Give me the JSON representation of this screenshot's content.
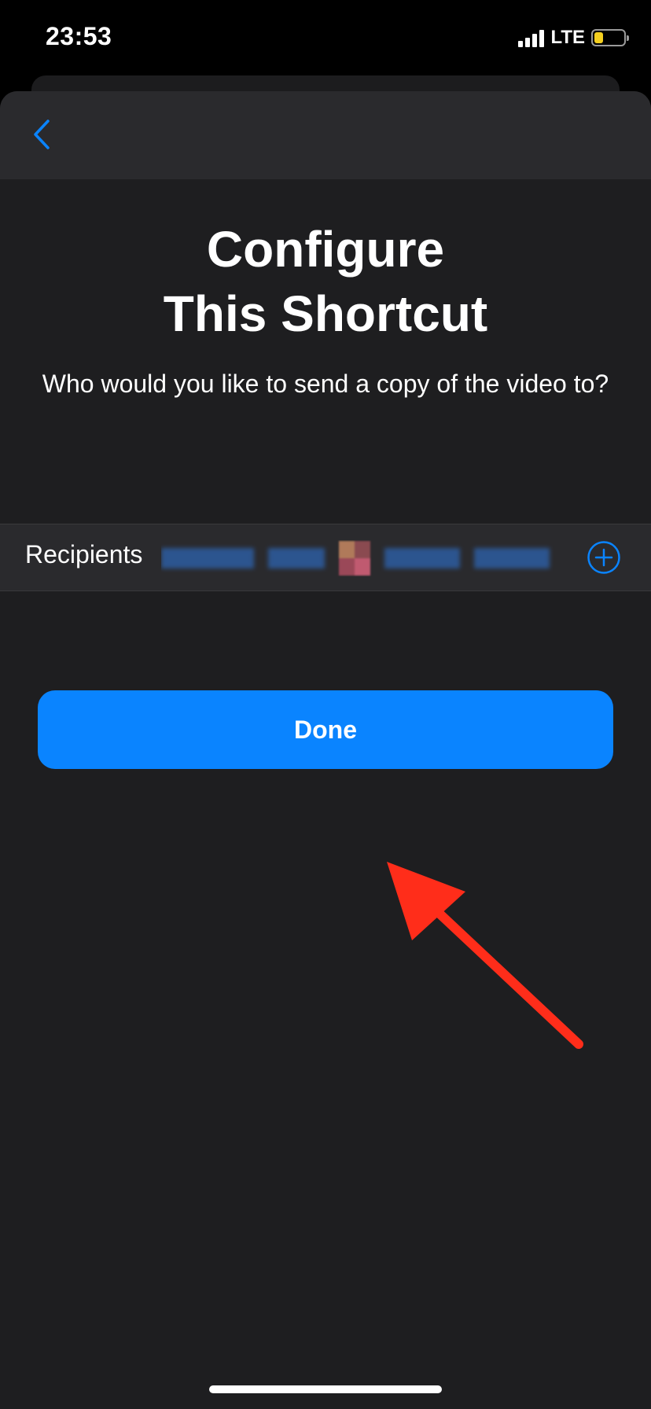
{
  "status_bar": {
    "time": "23:53",
    "network": "LTE",
    "signal_icon": "signal-bars-icon",
    "battery_icon": "battery-icon",
    "battery_color": "#f4cf1f",
    "battery_level": 0.3
  },
  "nav": {
    "back_icon": "chevron-left-icon",
    "accent_color": "#0a84ff"
  },
  "content": {
    "title_line1": "Configure",
    "title_line2": "This Shortcut",
    "question": "Who would you like to send a copy of the video to?"
  },
  "recipients": {
    "label": "Recipients",
    "value_redacted": true,
    "add_icon": "plus-circle-icon"
  },
  "done_button": {
    "label": "Done",
    "color": "#0a84ff"
  },
  "annotation": {
    "arrow_icon": "red-arrow-icon",
    "color": "#ff2d1a"
  }
}
